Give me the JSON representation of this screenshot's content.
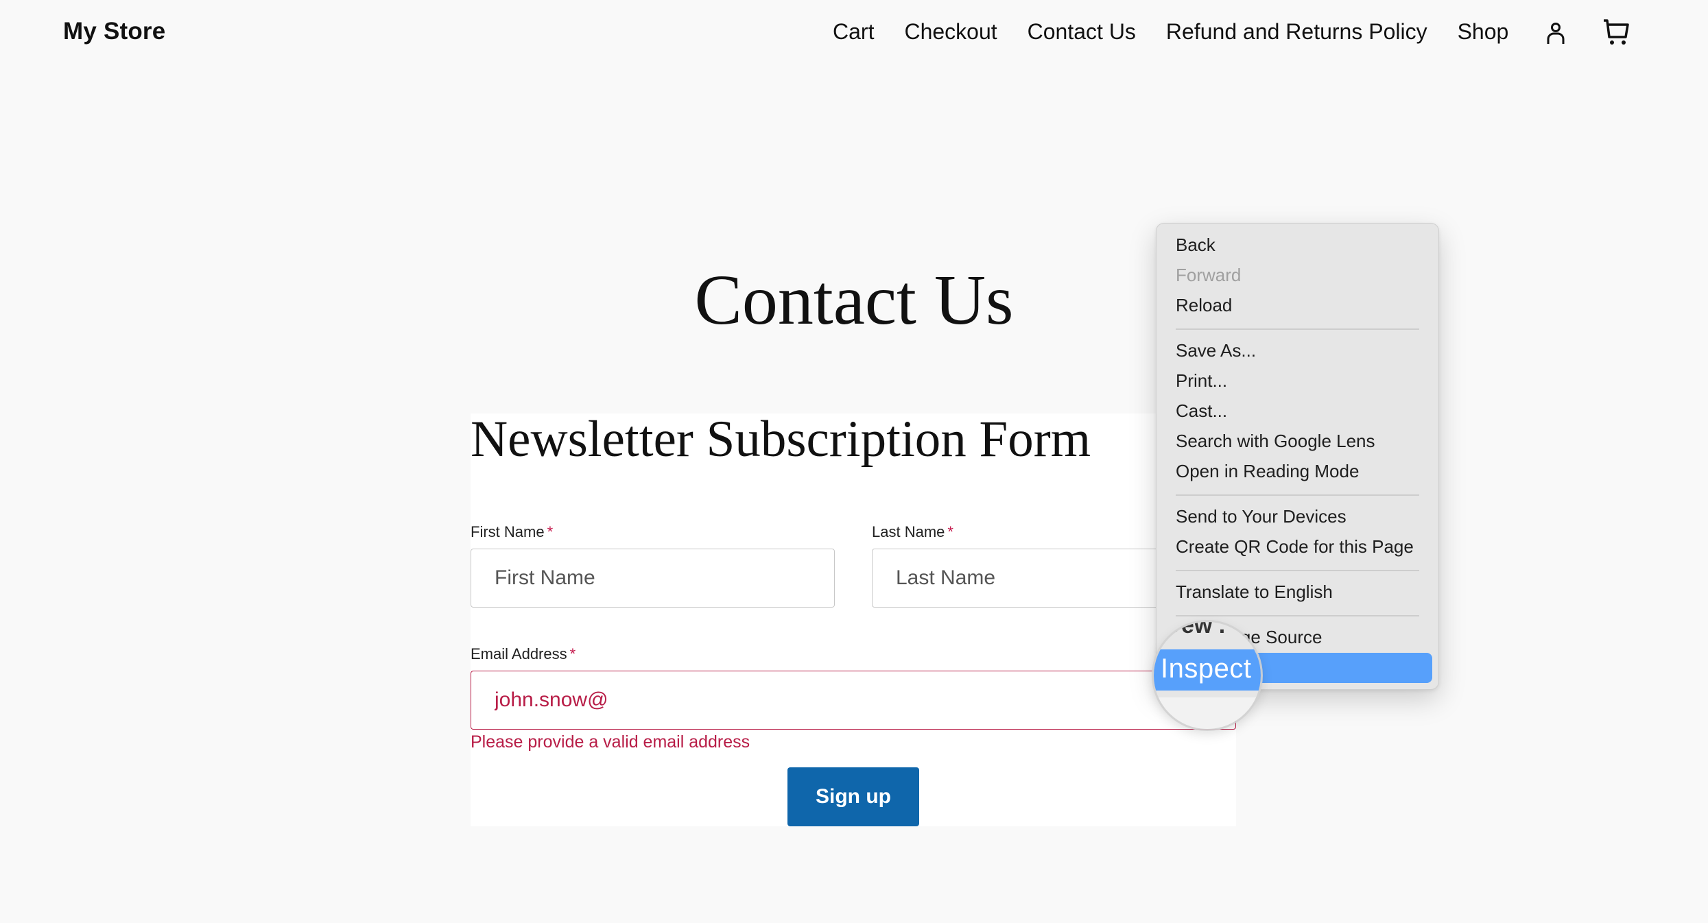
{
  "header": {
    "site_title": "My Store",
    "nav": [
      "Cart",
      "Checkout",
      "Contact Us",
      "Refund and Returns Policy",
      "Shop"
    ],
    "icons": {
      "account": "user-icon",
      "cart": "cart-icon"
    }
  },
  "page": {
    "title": "Contact Us"
  },
  "form": {
    "title": "Newsletter Subscription Form",
    "required_marker": "*",
    "first_name": {
      "label": "First Name",
      "placeholder": "First Name",
      "value": ""
    },
    "last_name": {
      "label": "Last Name",
      "placeholder": "Last Name",
      "value": ""
    },
    "email": {
      "label": "Email Address",
      "value": "john.snow@",
      "error": "Please provide a valid email address"
    },
    "submit_label": "Sign up",
    "colors": {
      "error": "#b81d47",
      "button": "#0f66ab"
    }
  },
  "context_menu": {
    "items": [
      {
        "label": "Back",
        "disabled": false
      },
      {
        "label": "Forward",
        "disabled": true
      },
      {
        "label": "Reload",
        "disabled": false
      },
      {
        "label": "Save As...",
        "disabled": false
      },
      {
        "label": "Print...",
        "disabled": false
      },
      {
        "label": "Cast...",
        "disabled": false
      },
      {
        "label": "Search with Google Lens",
        "disabled": false
      },
      {
        "label": "Open in Reading Mode",
        "disabled": false
      },
      {
        "label": "Send to Your Devices",
        "disabled": false
      },
      {
        "label": "Create QR Code for this Page",
        "disabled": false
      },
      {
        "label": "Translate to English",
        "disabled": false
      },
      {
        "label": "View Page Source",
        "visible_fragment": "ge Source",
        "disabled": false
      },
      {
        "label": "Inspect",
        "highlighted": true,
        "disabled": false
      }
    ],
    "highlight_color": "#57a0fb"
  },
  "magnifier": {
    "text": "Inspect",
    "top_fragment": "ew ."
  }
}
